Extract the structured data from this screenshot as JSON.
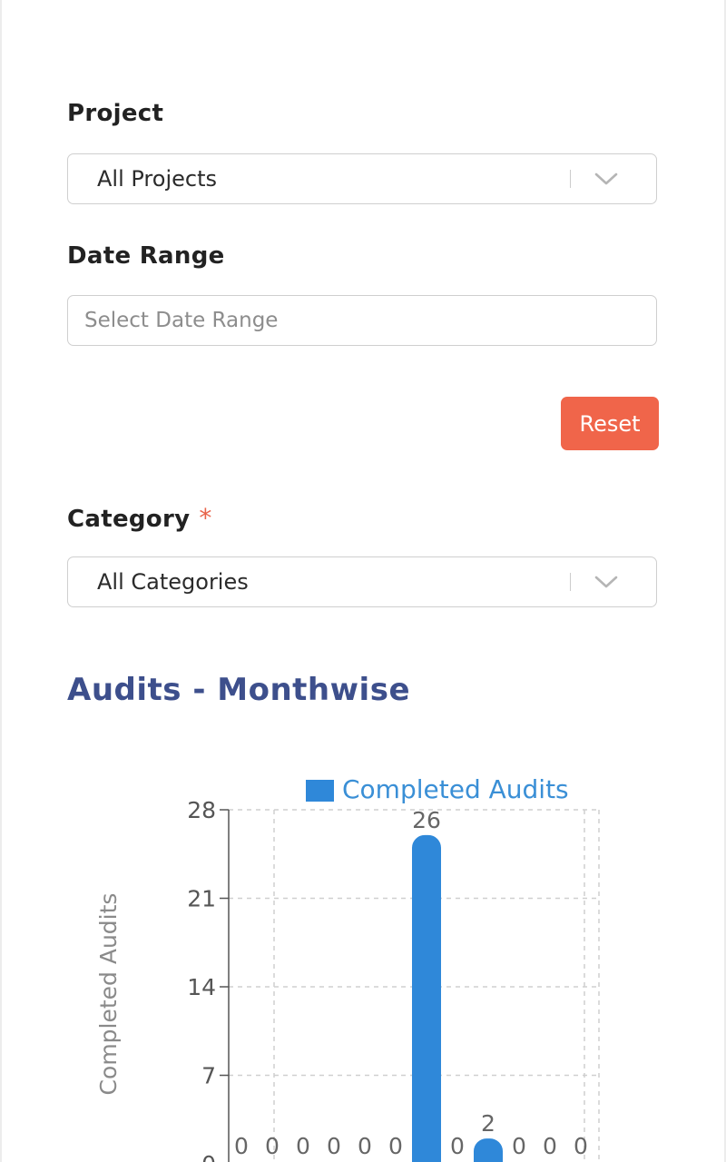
{
  "filters": {
    "project": {
      "label": "Project",
      "value": "All Projects"
    },
    "date_range": {
      "label": "Date Range",
      "placeholder": "Select Date Range",
      "value": ""
    },
    "reset_label": "Reset",
    "category": {
      "label": "Category",
      "required_mark": "*",
      "value": "All Categories"
    }
  },
  "section": {
    "title": "Audits - Monthwise"
  },
  "colors": {
    "accent": "#f0654a",
    "title": "#3d4f8c",
    "bar": "#2f88d9",
    "legend_text": "#3a8fd6"
  },
  "chart_data": {
    "type": "bar",
    "ylabel": "Completed Audits",
    "ylim": [
      0,
      28
    ],
    "yticks": [
      0,
      7,
      14,
      21,
      28
    ],
    "series": [
      {
        "name": "Completed Audits",
        "values": [
          0,
          0,
          0,
          0,
          0,
          0,
          26,
          0,
          2,
          0,
          0,
          0
        ]
      }
    ],
    "legend": {
      "position": "top"
    },
    "grid": true
  }
}
